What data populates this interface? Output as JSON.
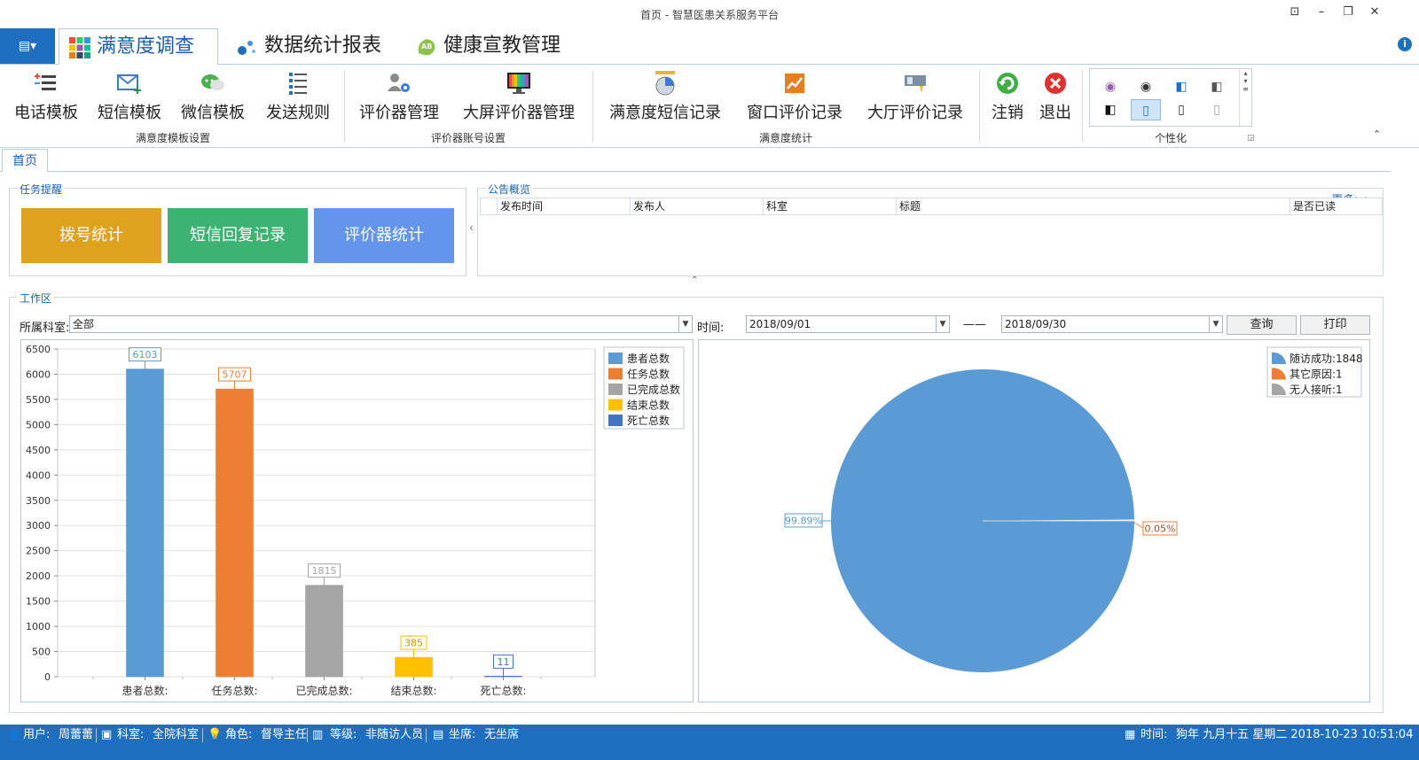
{
  "window": {
    "title": "首页 - 智慧医患关系服务平台"
  },
  "ribbon_tabs": [
    {
      "label": "满意度调查",
      "icon": "grid-icon",
      "active": true
    },
    {
      "label": "数据统计报表",
      "icon": "dots-icon",
      "active": false
    },
    {
      "label": "健康宣教管理",
      "icon": "ab-icon",
      "active": false
    }
  ],
  "ribbon_groups": [
    {
      "label": "满意度模板设置",
      "buttons": [
        "电话模板",
        "短信模板",
        "微信模板",
        "发送规则"
      ]
    },
    {
      "label": "评价器账号设置",
      "buttons": [
        "评价器管理",
        "大屏评价器管理"
      ]
    },
    {
      "label": "满意度统计",
      "buttons": [
        "满意度短信记录",
        "窗口评价记录",
        "大厅评价记录"
      ]
    },
    {
      "label": "",
      "buttons": [
        "注销",
        "退出"
      ]
    },
    {
      "label": "个性化",
      "buttons": []
    }
  ],
  "doc_tab": "首页",
  "task_panel": {
    "legend": "任务提醒",
    "tiles": [
      {
        "label": "拨号统计",
        "color": "#dea21e"
      },
      {
        "label": "短信回复记录",
        "color": "#3cb371"
      },
      {
        "label": "评价器统计",
        "color": "#6495ed"
      }
    ]
  },
  "notice_panel": {
    "legend": "公告概览",
    "more": "更多>>",
    "columns": [
      "发布时间",
      "发布人",
      "科室",
      "标题",
      "是否已读"
    ]
  },
  "work_panel": {
    "legend": "工作区",
    "dept_label": "所属科室:",
    "dept_value": "全部",
    "time_label": "时间:",
    "date_from": "2018/09/01",
    "date_sep": "——",
    "date_to": "2018/09/30",
    "query_button": "查询",
    "print_button": "打印"
  },
  "chart_data": [
    {
      "type": "bar",
      "categories": [
        "患者总数:",
        "任务总数:",
        "已完成总数:",
        "结束总数:",
        "死亡总数:"
      ],
      "values": [
        6103,
        5707,
        1815,
        385,
        11
      ],
      "colors": [
        "#5b9bd5",
        "#ed7d31",
        "#a5a5a5",
        "#ffc000",
        "#4472c4"
      ],
      "legend": [
        "患者总数",
        "任务总数",
        "已完成总数",
        "结束总数",
        "死亡总数"
      ],
      "ylim": [
        0,
        6500
      ],
      "yticks": [
        0,
        500,
        1000,
        1500,
        2000,
        2500,
        3000,
        3500,
        4000,
        4500,
        5000,
        5500,
        6000,
        6500
      ],
      "grid": true,
      "legend_position": "top-right"
    },
    {
      "type": "pie",
      "slices": [
        {
          "name": "随访成功:1848",
          "value": 1848,
          "label": "99.89%",
          "color": "#5b9bd5"
        },
        {
          "name": "其它原因:1",
          "value": 1,
          "label": "0.05%",
          "color": "#ed7d31"
        },
        {
          "name": "无人接听:1",
          "value": 1,
          "label": "",
          "color": "#a5a5a5"
        }
      ],
      "legend_position": "top-right"
    }
  ],
  "statusbar": {
    "user_label": "用户:",
    "user_value": "周蕾蕾",
    "dept_label": "科室:",
    "dept_value": "全院科室",
    "role_label": "角色:",
    "role_value": "督导主任",
    "level_label": "等级:",
    "level_value": "非随访人员",
    "seat_label": "坐席:",
    "seat_value": "无坐席",
    "time_label": "时间:",
    "time_value": "狗年 九月十五 星期二 2018-10-23 10:51:04"
  }
}
